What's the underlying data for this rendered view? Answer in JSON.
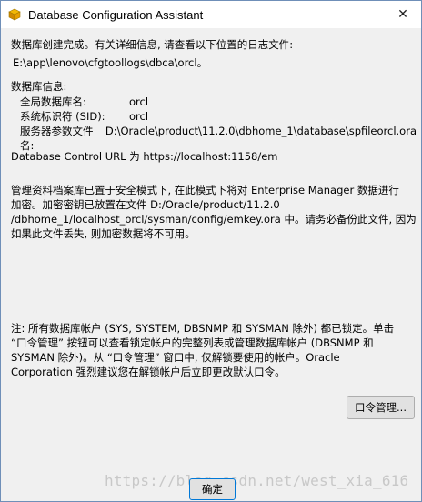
{
  "window": {
    "title": "Database Configuration Assistant",
    "close_glyph": "✕"
  },
  "messages": {
    "completion": "数据库创建完成。有关详细信息, 请查看以下位置的日志文件:",
    "log_path": "E:\\app\\lenovo\\cfgtoollogs\\dbca\\orcl。",
    "db_info_heading": "数据库信息:",
    "db_info": [
      {
        "label": "全局数据库名:",
        "value": "orcl"
      },
      {
        "label": "系统标识符 (SID):",
        "value": "orcl"
      },
      {
        "label": "服务器参数文件名:",
        "value": "D:\\Oracle\\product\\11.2.0\\dbhome_1\\database\\spfileorcl.ora"
      }
    ],
    "dbcontrol_url": "Database Control URL 为 https://localhost:1158/em",
    "repository_lines": [
      "管理资料档案库已置于安全模式下, 在此模式下将对 Enterprise Manager 数据进行",
      "加密。加密密钥已放置在文件 D:/Oracle/product/11.2.0",
      "/dbhome_1/localhost_orcl/sysman/config/emkey.ora 中。请务必备份此文件, 因为",
      "如果此文件丢失, 则加密数据将不可用。"
    ],
    "note_lines": [
      "注: 所有数据库帐户 (SYS, SYSTEM, DBSNMP 和 SYSMAN 除外) 都已锁定。单击",
      "“口令管理” 按钮可以查看锁定帐户的完整列表或管理数据库帐户 (DBSNMP 和",
      "SYSMAN 除外)。从 “口令管理” 窗口中, 仅解锁要使用的帐户。Oracle",
      "Corporation 强烈建议您在解锁帐户后立即更改默认口令。"
    ]
  },
  "buttons": {
    "password_management": "口令管理...",
    "ok": "确定"
  },
  "watermark": "https://blog.csdn.net/west_xia_616"
}
